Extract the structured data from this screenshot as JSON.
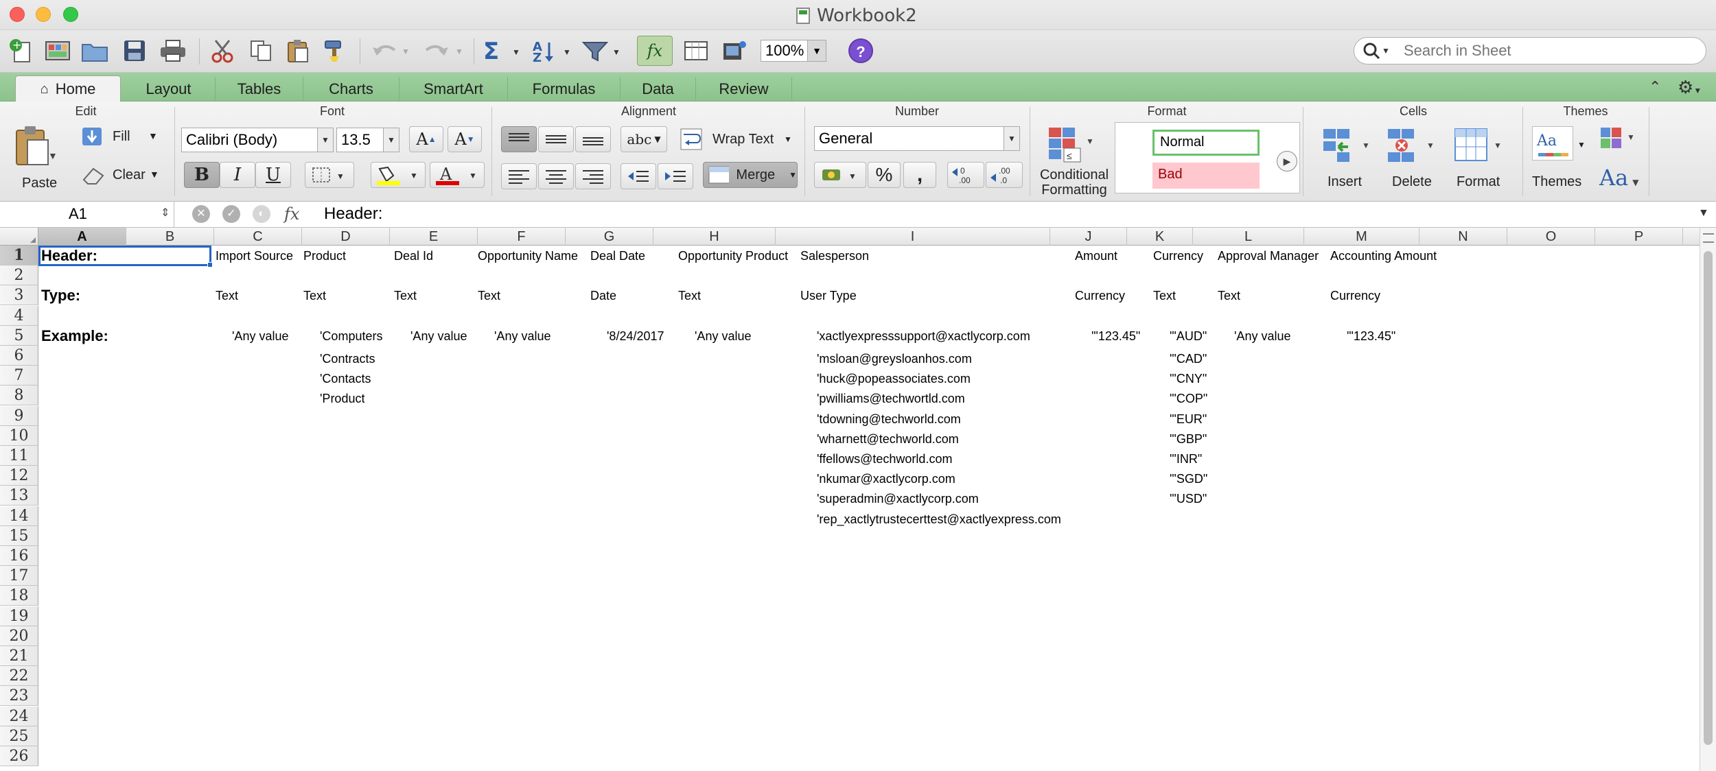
{
  "window": {
    "title": "Workbook2"
  },
  "toolbar": {
    "zoom": "100%",
    "search_placeholder": "Search in Sheet",
    "help": "?"
  },
  "tabs": [
    "Home",
    "Layout",
    "Tables",
    "Charts",
    "SmartArt",
    "Formulas",
    "Data",
    "Review"
  ],
  "ribbon": {
    "groups": {
      "edit": "Edit",
      "font": "Font",
      "alignment": "Alignment",
      "number": "Number",
      "format": "Format",
      "cells": "Cells",
      "themes": "Themes"
    },
    "edit": {
      "paste": "Paste",
      "fill": "Fill",
      "clear": "Clear"
    },
    "font": {
      "family": "Calibri (Body)",
      "size": "13.5",
      "bold": "B",
      "italic": "I",
      "underline": "U",
      "grow": "A",
      "shrink": "A",
      "color_letter": "A"
    },
    "alignment": {
      "wrap_text": "Wrap Text",
      "merge": "Merge",
      "abc": "abc"
    },
    "number": {
      "format": "General",
      "percent": "%",
      "comma": ","
    },
    "format": {
      "conditional_formatting_line1": "Conditional",
      "conditional_formatting_line2": "Formatting",
      "style_normal": "Normal",
      "style_bad": "Bad"
    },
    "cells": {
      "insert": "Insert",
      "delete": "Delete",
      "format": "Format"
    },
    "themes": {
      "themes": "Themes",
      "fonts": "Aa",
      "theme_preview": "Aa"
    }
  },
  "formula_bar": {
    "name_box": "A1",
    "fx": "fx",
    "content": "Header:"
  },
  "columns": [
    "A",
    "B",
    "C",
    "D",
    "E",
    "F",
    "G",
    "H",
    "I",
    "J",
    "K",
    "L",
    "M",
    "N",
    "O",
    "P"
  ],
  "rows": [
    "1",
    "2",
    "3",
    "4",
    "5",
    "6",
    "7",
    "8",
    "9",
    "10",
    "11",
    "12",
    "13",
    "14",
    "15",
    "16",
    "17",
    "18",
    "19",
    "20",
    "21",
    "22",
    "23",
    "24",
    "25",
    "26"
  ],
  "selected": {
    "column": "A",
    "row": "1"
  },
  "cells": {
    "row1": {
      "A": "Header:",
      "C": "Import Source",
      "D": "Product",
      "E": "Deal Id",
      "F": "Opportunity Name",
      "G": "Deal Date",
      "H": "Opportunity Product",
      "I": "Salesperson",
      "J": "Amount",
      "K": "Currency",
      "L": "Approval Manager",
      "M": "Accounting Amount"
    },
    "row3": {
      "A": "Type:",
      "C": "Text",
      "D": "Text",
      "E": "Text",
      "F": "Text",
      "G": "Date",
      "H": "Text",
      "I": "User Type",
      "J": "Currency",
      "K": "Text",
      "L": "Text",
      "M": "Currency"
    },
    "row5": {
      "A": "Example:",
      "C": "'Any value",
      "D": "'Computers",
      "E": "'Any value",
      "F": "'Any value",
      "G": "'8/24/2017",
      "H": "'Any value",
      "I": "'xactlyexpresssupport@xactlycorp.com",
      "J": "'\"123.45\"",
      "K": "'\"AUD\"",
      "L": "'Any value",
      "M": "'\"123.45\""
    },
    "row6": {
      "D": "'Contracts",
      "I": "'msloan@greysloanhos.com",
      "K": "'\"CAD\""
    },
    "row7": {
      "D": "'Contacts",
      "I": "'huck@popeassociates.com",
      "K": "'\"CNY\""
    },
    "row8": {
      "D": "'Product",
      "I": "'pwilliams@techwortld.com",
      "K": "'\"COP\""
    },
    "row9": {
      "I": "'tdowning@techworld.com",
      "K": "'\"EUR\""
    },
    "row10": {
      "I": "'wharnett@techworld.com",
      "K": "'\"GBP\""
    },
    "row11": {
      "I": "'ffellows@techworld.com",
      "K": "'\"INR\""
    },
    "row12": {
      "I": "'nkumar@xactlycorp.com",
      "K": "'\"SGD\""
    },
    "row13": {
      "I": "'superadmin@xactlycorp.com",
      "K": "'\"USD\""
    },
    "row14": {
      "I": "'rep_xactlytrustecerttest@xactlyexpress.com"
    }
  }
}
